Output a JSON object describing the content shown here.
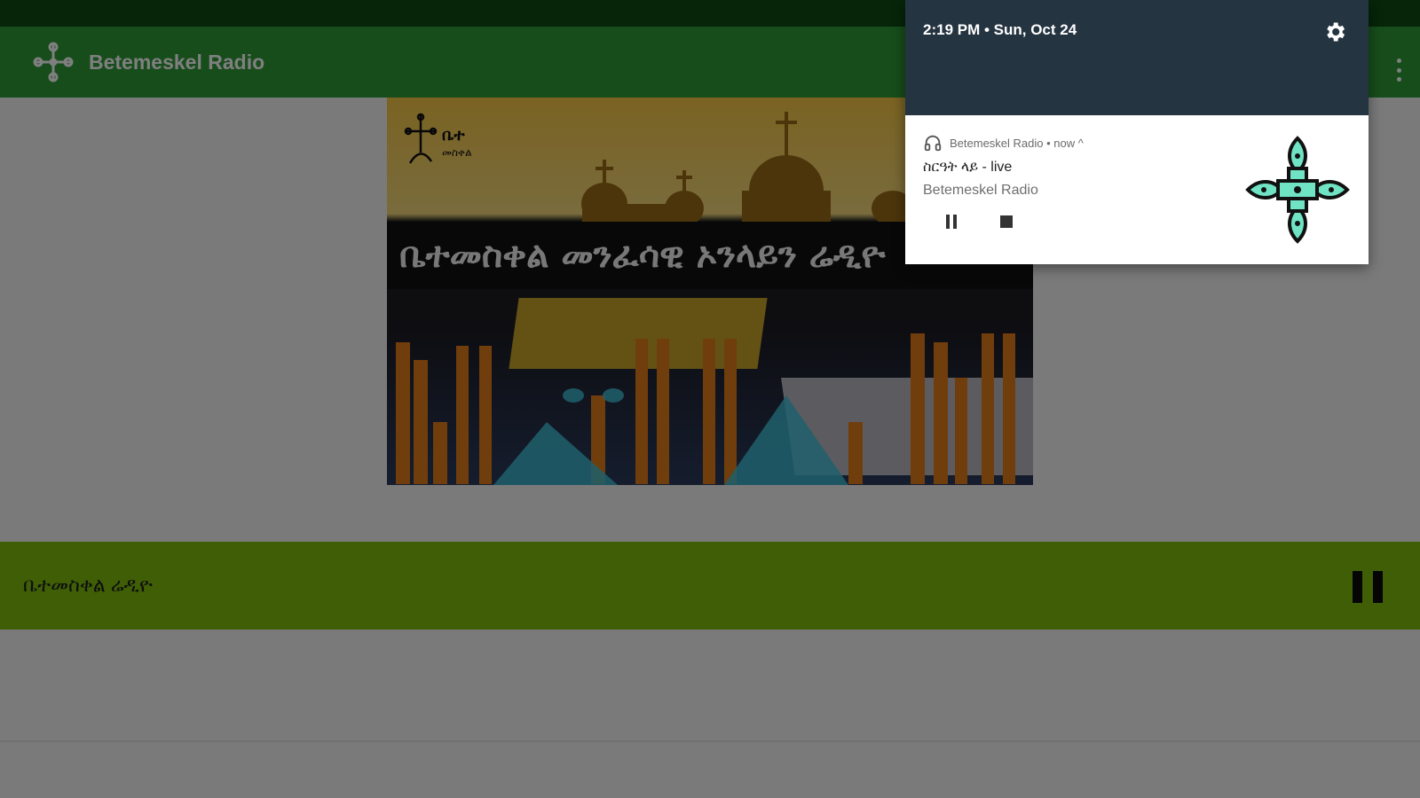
{
  "app": {
    "title": "Betemeskel Radio",
    "banner": {
      "text": "ቤተመስቀል መንፈሳዊ ኦንላይን ሬዲዮ",
      "brand_line1": "ቤተ",
      "brand_line2": "መስቀል"
    },
    "player": {
      "station": "ቤተመስቀል ሬዲዮ",
      "state_icon": "pause-icon"
    }
  },
  "shade": {
    "datetime": "2:19 PM • Sun, Oct 24",
    "notification": {
      "header": "Betemeskel Radio • now ^",
      "song": "ስርዓት ላይ - live",
      "artist": "Betemeskel Radio",
      "controls": [
        "pause-icon",
        "stop-icon"
      ]
    }
  },
  "colors": {
    "status_bar": "#0d4a12",
    "app_bar": "#2e9b37",
    "player_bar": "#7ebd0b",
    "shade_header": "#253441",
    "cross_art": "#6fe3c4"
  }
}
